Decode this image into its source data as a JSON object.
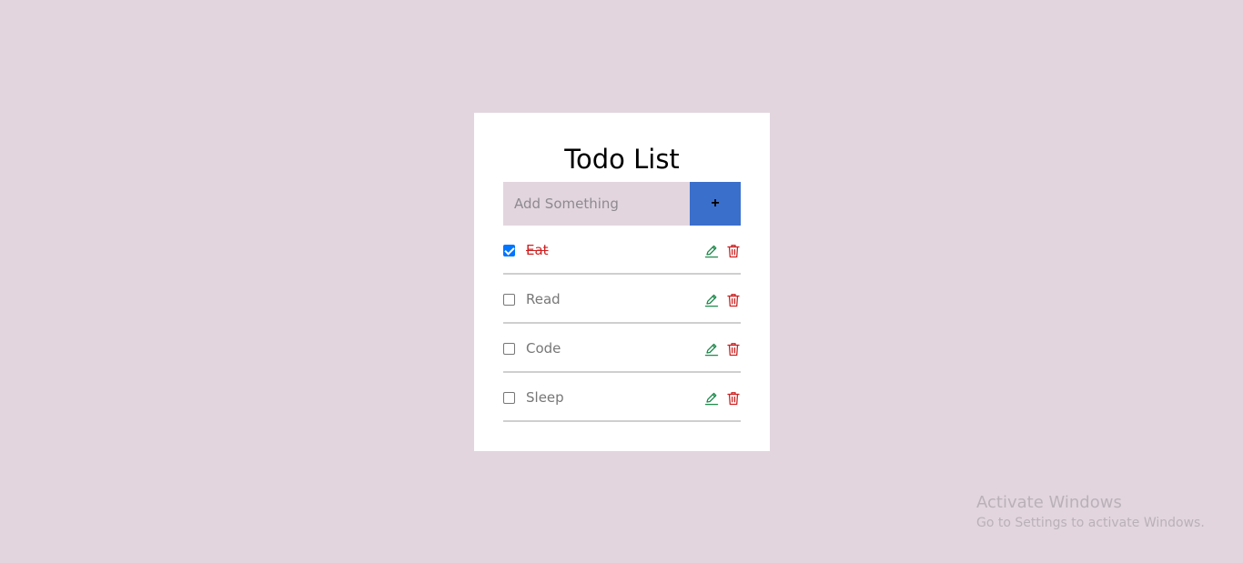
{
  "app": {
    "title": "Todo List"
  },
  "add_form": {
    "placeholder": "Add Something",
    "value": "",
    "button_label": "+"
  },
  "todos": [
    {
      "label": "Eat",
      "done": true
    },
    {
      "label": "Read",
      "done": false
    },
    {
      "label": "Code",
      "done": false
    },
    {
      "label": "Sleep",
      "done": false
    }
  ],
  "icons": {
    "edit": "pencil-icon",
    "delete": "trash-icon"
  },
  "colors": {
    "background": "#e2d5de",
    "card": "#ffffff",
    "input_bg": "#e2d5de",
    "add_button": "#3b6fcc",
    "edit_icon": "#1f8a4c",
    "delete_icon": "#cc2222",
    "done_text": "#cc2222",
    "checkbox_checked": "#0075ff"
  },
  "watermark": {
    "title": "Activate Windows",
    "subtitle": "Go to Settings to activate Windows."
  }
}
